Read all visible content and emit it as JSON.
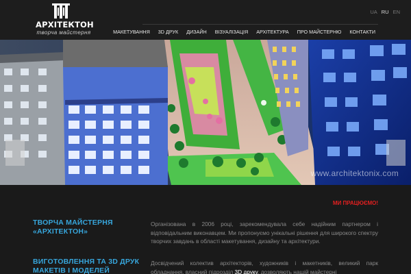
{
  "brand": {
    "name": "АРХІТЕКТОН",
    "tagline": "творча майстерня"
  },
  "languages": [
    {
      "code": "UA",
      "active": false
    },
    {
      "code": "RU",
      "active": true
    },
    {
      "code": "EN",
      "active": false
    }
  ],
  "nav": {
    "items": [
      "МАКЕТУВАННЯ",
      "3D ДРУК",
      "ДИЗАЙН",
      "ВІЗУАЛІЗАЦІЯ",
      "АРХІТЕКТУРА",
      "ПРО МАЙСТЕРНЮ",
      "КОНТАКТИ"
    ]
  },
  "hero": {
    "watermark": "www.architektonix.com"
  },
  "main": {
    "tagline": "МИ ПРАЦЮЄМО!",
    "sections": [
      {
        "title_line1": "ТВОРЧА МАЙСТЕРНЯ",
        "title_line2": "«АРХІТЕКТОН»",
        "text": "Організована в 2006 році, зарекомендувала себе надійним партнером і відповідальним виконавцем. Ми пропонуємо унікальні рішення для широкого спектру творчих завдань в області макетування, дизайну та архітектури."
      },
      {
        "title_line1": "ВИГОТОВЛЕННЯ ТА 3D ДРУК",
        "title_line2": "МАКЕТІВ І МОДЕЛЕЙ",
        "text_before": "Досвідчений колектив архітекторів, художників і макетників, великий парк обладнання, власний підрозділ ",
        "text_highlight": "3D друку",
        "text_after": ", дозволяють нашій майстерні"
      }
    ]
  },
  "colors": {
    "accent": "#37a6dc",
    "alert": "#e02020",
    "background": "#1a1a1a"
  }
}
